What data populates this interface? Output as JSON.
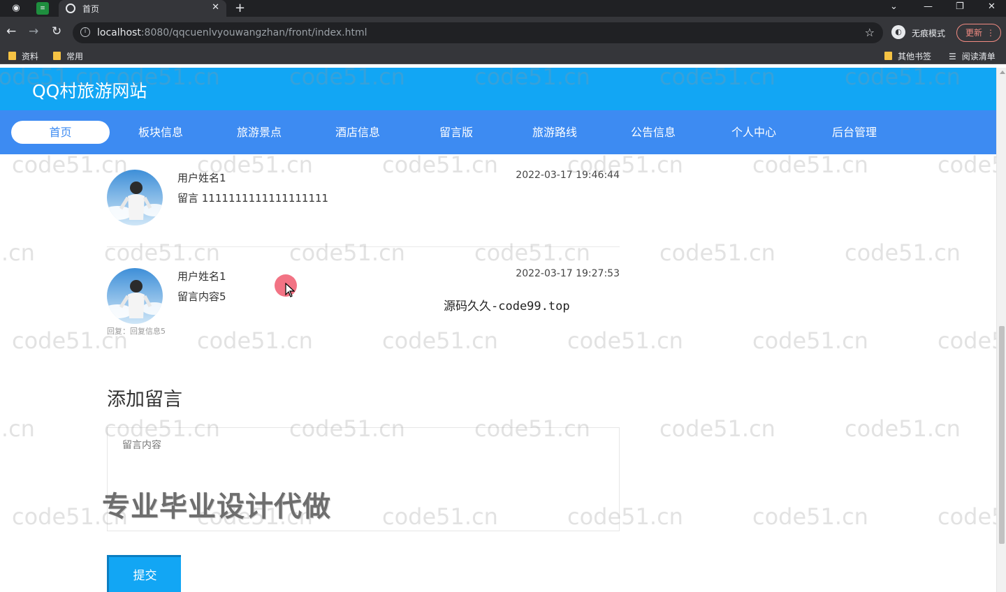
{
  "browser": {
    "tab_title": "首页",
    "new_tab": "+",
    "url_host": "localhost",
    "url_rest": ":8080/qqcuenlvyouwangzhan/front/index.html",
    "incognito_label": "无痕模式",
    "update_label": "更新",
    "bookmarks": [
      "资料",
      "常用"
    ],
    "bookmarks_right": [
      "其他书签",
      "阅读清单"
    ]
  },
  "site": {
    "title": "QQ村旅游网站",
    "nav": [
      "首页",
      "板块信息",
      "旅游景点",
      "酒店信息",
      "留言版",
      "旅游路线",
      "公告信息",
      "个人中心",
      "后台管理"
    ],
    "active_nav": "首页"
  },
  "messages": [
    {
      "user": "用户姓名1",
      "text": "留言 1111111111111111111",
      "time": "2022-03-17 19:46:44",
      "reply": ""
    },
    {
      "user": "用户姓名1",
      "text": "留言内容5",
      "time": "2022-03-17 19:27:53",
      "reply": "回复：回复信息5"
    }
  ],
  "form": {
    "title": "添加留言",
    "placeholder": "留言内容",
    "submit_label": "提交"
  },
  "watermarks": {
    "repeat": "code51.cn",
    "center": "源码久久-code99.top",
    "promo": "专业毕业设计代做"
  },
  "colors": {
    "header": "#12a6f4",
    "navbar": "#3d8bf2",
    "cursor_highlight": "#f05a6e"
  }
}
